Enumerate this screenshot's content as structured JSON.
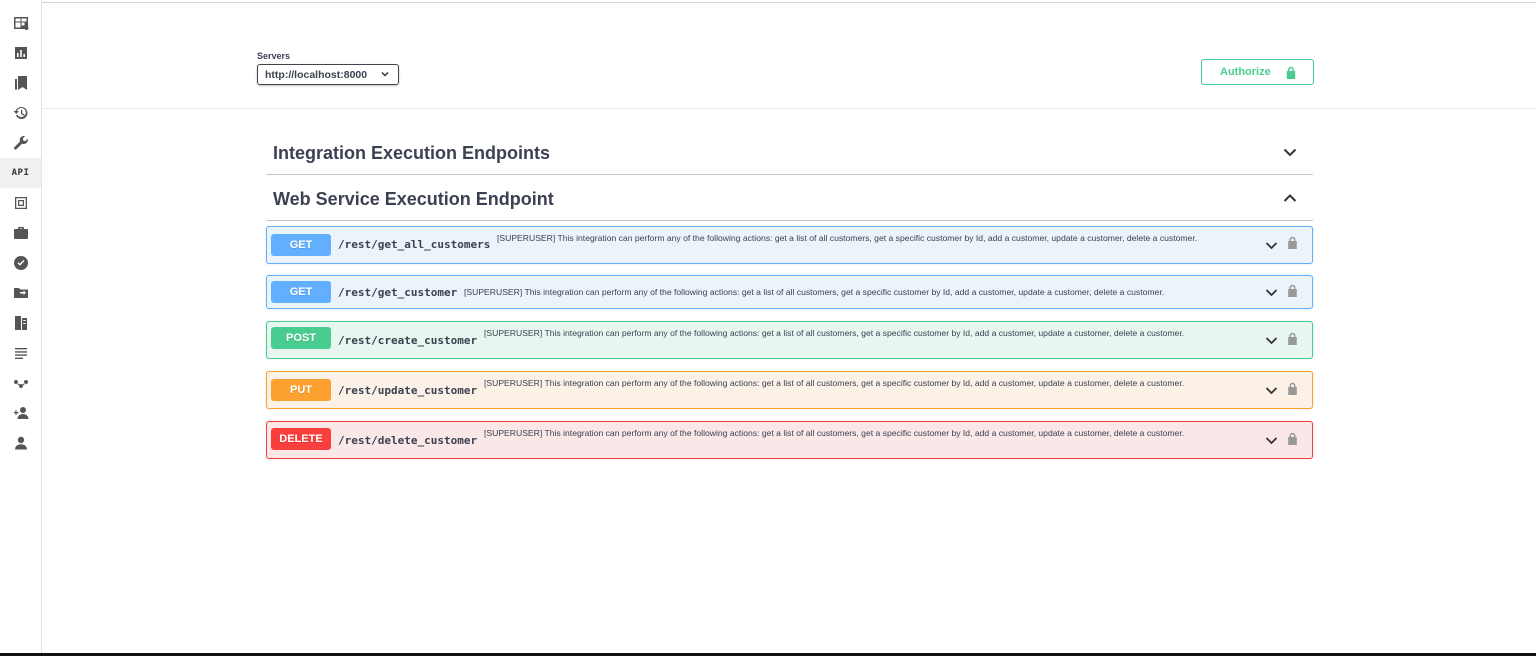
{
  "sidebar": {
    "items": [
      {
        "icon": "dashboard-grid-icon"
      },
      {
        "icon": "bar-chart-icon"
      },
      {
        "icon": "bookmarks-icon"
      },
      {
        "icon": "history-icon"
      },
      {
        "icon": "wrench-icon"
      },
      {
        "icon": "api-text-icon",
        "label": "API",
        "active": true
      },
      {
        "icon": "safe-icon"
      },
      {
        "icon": "briefcase-icon"
      },
      {
        "icon": "check-circle-icon"
      },
      {
        "icon": "folder-move-icon"
      },
      {
        "icon": "document-compare-icon"
      },
      {
        "icon": "list-lines-icon"
      },
      {
        "icon": "connection-icon"
      },
      {
        "icon": "add-user-icon"
      },
      {
        "icon": "user-icon"
      }
    ]
  },
  "servers": {
    "label": "Servers",
    "selected": "http://localhost:8000"
  },
  "authorize": {
    "label": "Authorize"
  },
  "tags": [
    {
      "title": "Integration Execution Endpoints",
      "expanded": false
    },
    {
      "title": "Web Service Execution Endpoint",
      "expanded": true
    }
  ],
  "operations": [
    {
      "method": "GET",
      "path": "/rest/get_all_customers",
      "description": "[SUPERUSER] This integration can perform any of the following actions: get a list of all customers, get a specific customer by Id, add a customer, update a customer, delete a customer."
    },
    {
      "method": "GET",
      "path": "/rest/get_customer",
      "description": "[SUPERUSER] This integration can perform any of the following actions: get a list of all customers, get a specific customer by Id, add a customer, update a customer, delete a customer."
    },
    {
      "method": "POST",
      "path": "/rest/create_customer",
      "description": "[SUPERUSER] This integration can perform any of the following actions: get a list of all customers, get a specific customer by Id, add a customer, update a customer, delete a customer."
    },
    {
      "method": "PUT",
      "path": "/rest/update_customer",
      "description": "[SUPERUSER] This integration can perform any of the following actions: get a list of all customers, get a specific customer by Id, add a customer, update a customer, delete a customer."
    },
    {
      "method": "DELETE",
      "path": "/rest/delete_customer",
      "description": "[SUPERUSER] This integration can perform any of the following actions: get a list of all customers, get a specific customer by Id, add a customer, update a customer, delete a customer."
    }
  ],
  "colors": {
    "get": "#61affe",
    "post": "#49cc90",
    "put": "#fca130",
    "delete": "#f93e3e",
    "authorize": "#49cc90"
  }
}
